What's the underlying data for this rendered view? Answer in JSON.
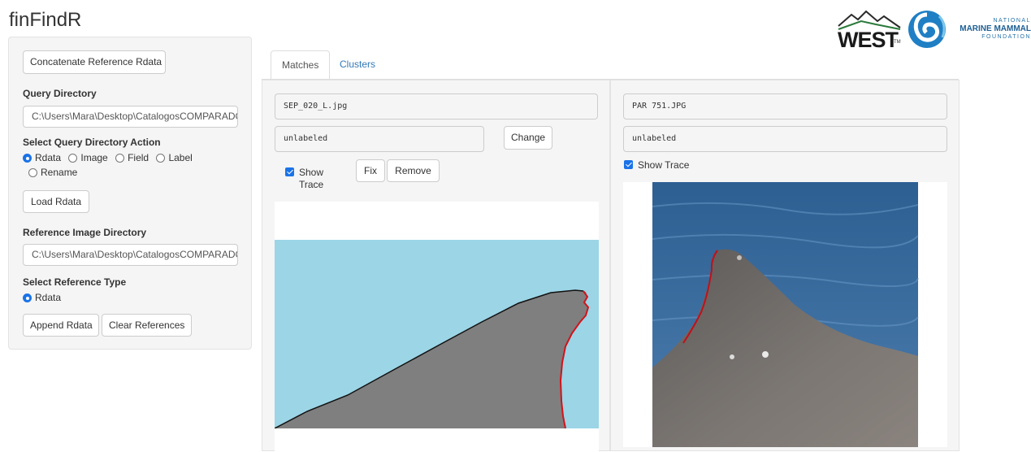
{
  "app": {
    "title": "finFindR"
  },
  "logos": {
    "west": {
      "text": "WEST",
      "tm": "TM"
    },
    "nmmf": {
      "line1": "NATIONAL",
      "line2": "MARINE MAMMAL",
      "line3": "FOUNDATION"
    }
  },
  "sidebar": {
    "concat_button": "Concatenate Reference Rdata",
    "query_dir_label": "Query Directory",
    "query_dir_value": "C:\\Users\\Mara\\Desktop\\CatalogosCOMPARADOS",
    "query_action_label": "Select Query Directory Action",
    "query_actions": [
      "Rdata",
      "Image",
      "Field",
      "Label",
      "Rename"
    ],
    "query_action_selected": "Rdata",
    "load_button": "Load Rdata",
    "ref_dir_label": "Reference Image Directory",
    "ref_dir_value": "C:\\Users\\Mara\\Desktop\\CatalogosCOMPARADOS",
    "ref_type_label": "Select Reference Type",
    "ref_types": [
      "Rdata"
    ],
    "append_button": "Append Rdata",
    "clear_button": "Clear References"
  },
  "tabs": [
    {
      "label": "Matches",
      "active": true
    },
    {
      "label": "Clusters",
      "active": false
    }
  ],
  "left_panel": {
    "filename": "SEP_020_L.jpg",
    "label": "unlabeled",
    "change_button": "Change",
    "show_trace_line1": "Show",
    "show_trace_line2": "Trace",
    "show_trace_checked": true,
    "fix_button": "Fix",
    "remove_button": "Remove"
  },
  "right_panel": {
    "filename": "PAR 751.JPG",
    "label": "unlabeled",
    "show_trace": "Show Trace",
    "show_trace_checked": true
  },
  "colors": {
    "accent": "#1a73e8",
    "link": "#337ab7",
    "sky": "#9bd5e6",
    "fin": "#7f7f7f",
    "trace": "#d3131b",
    "sea": "#3e6ea0"
  }
}
